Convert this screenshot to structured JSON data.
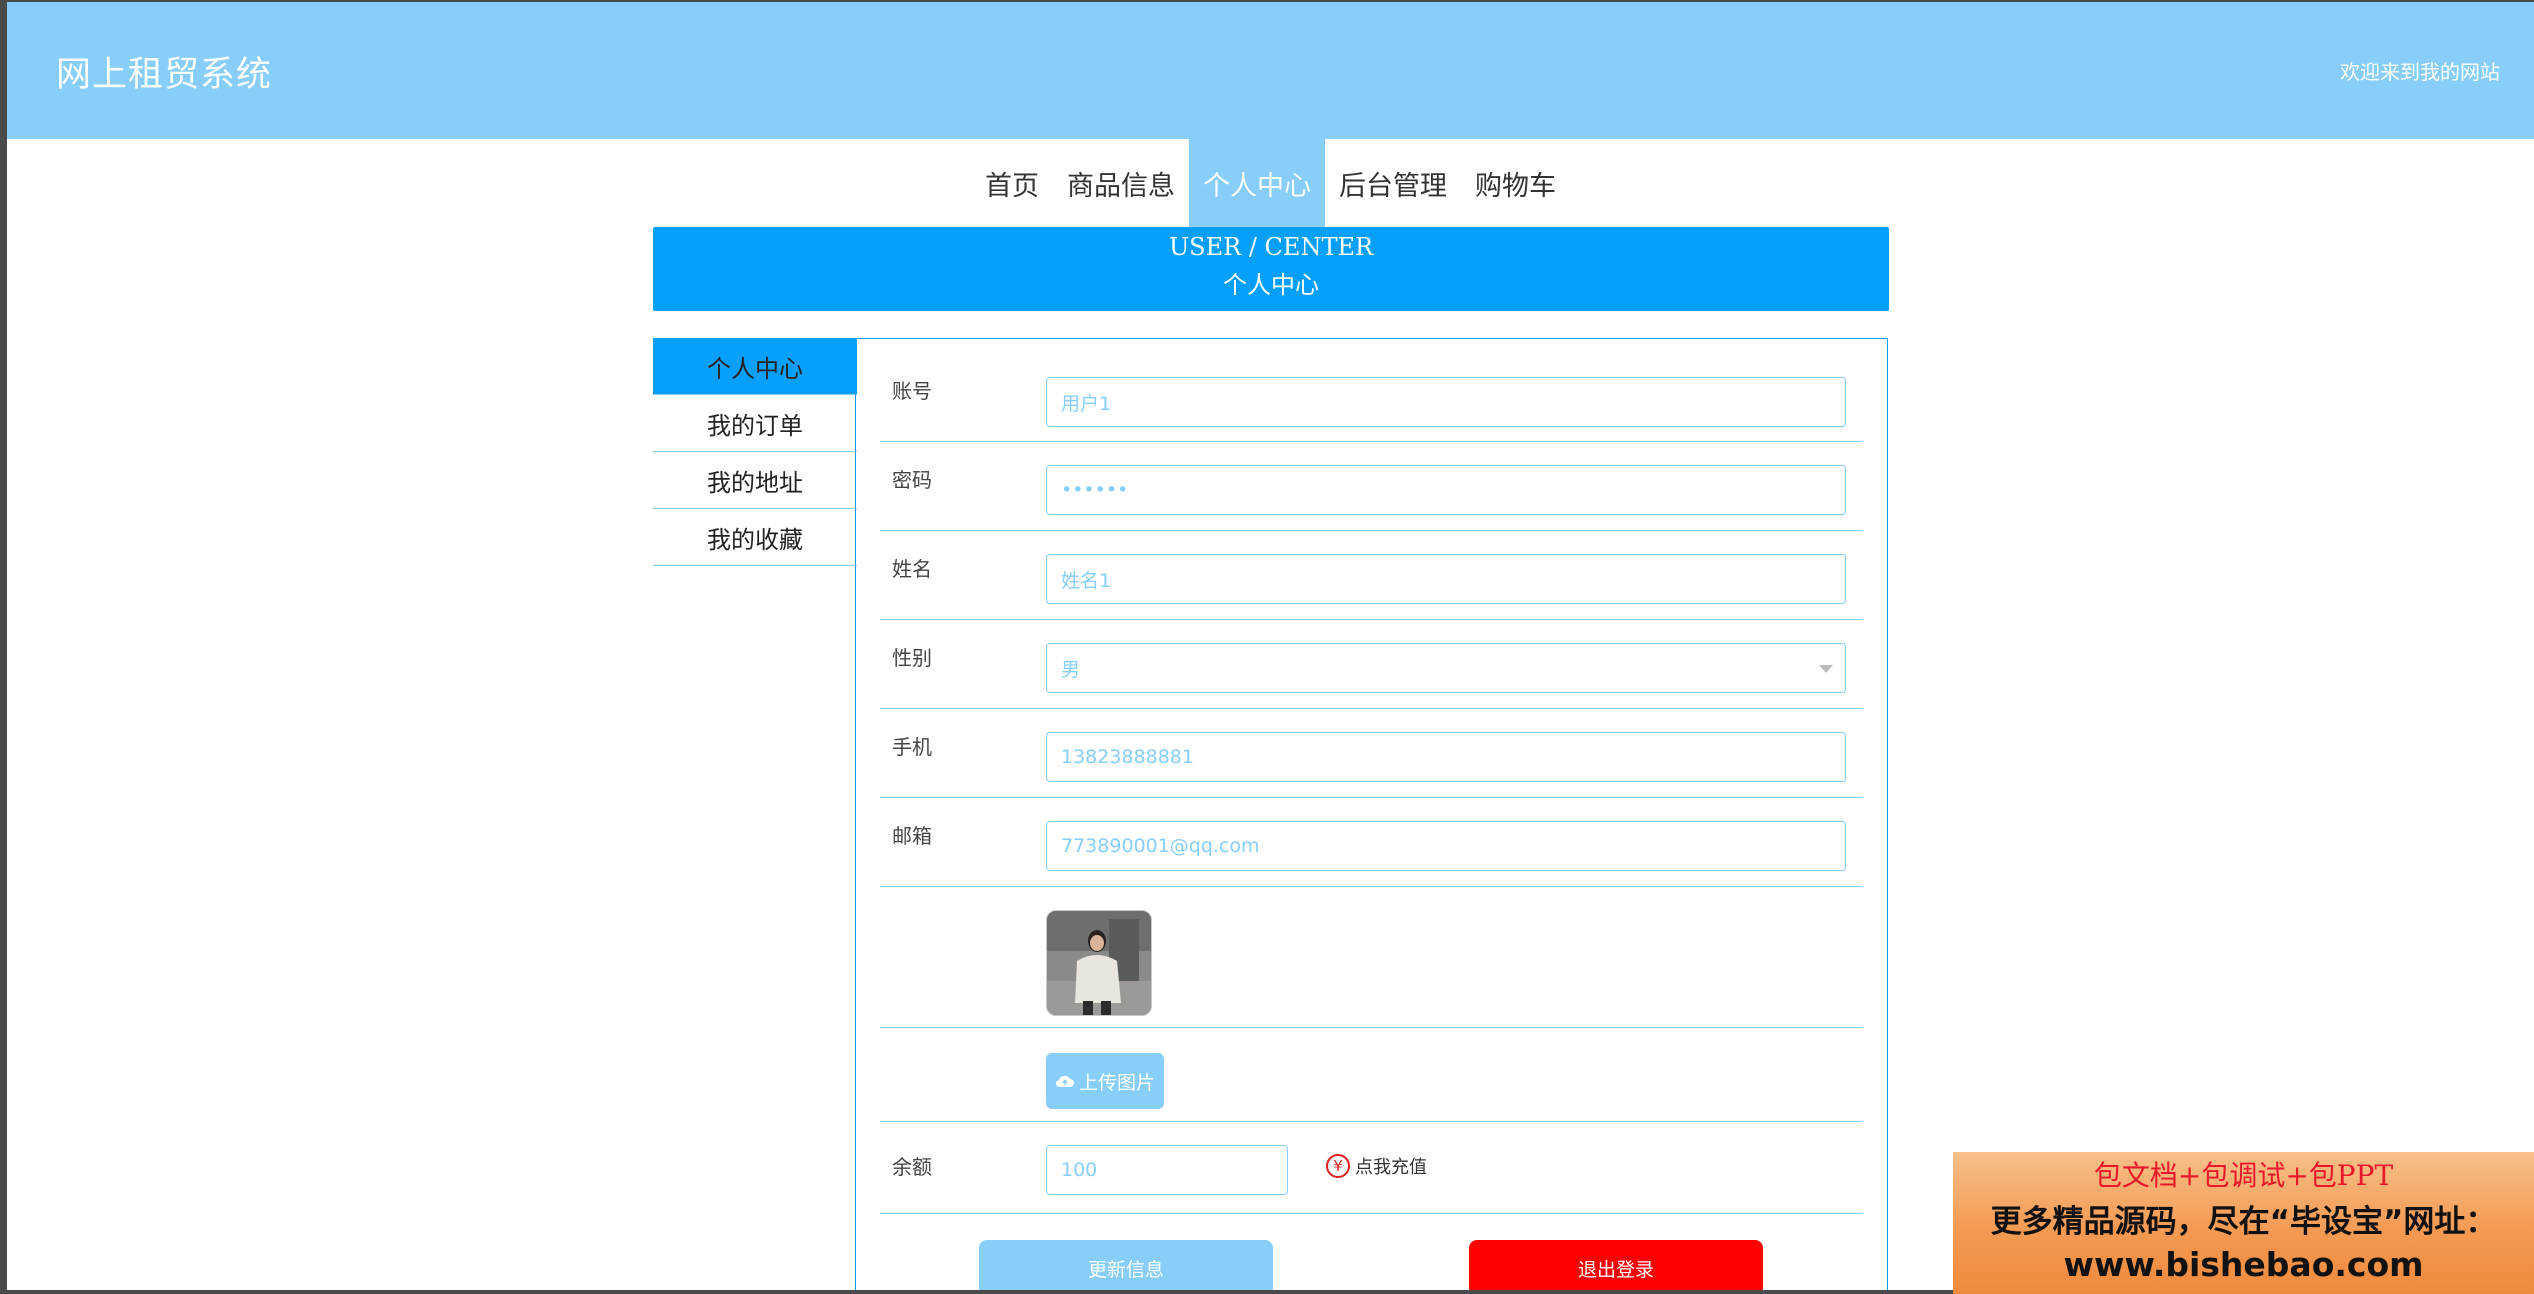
{
  "header": {
    "site_title": "网上租贸系统",
    "welcome": "欢迎来到我的网站"
  },
  "nav": {
    "items": [
      {
        "label": "首页"
      },
      {
        "label": "商品信息"
      },
      {
        "label": "个人中心"
      },
      {
        "label": "后台管理"
      },
      {
        "label": "购物车"
      }
    ],
    "active": "个人中心"
  },
  "banner": {
    "en": "USER / CENTER",
    "cn": "个人中心"
  },
  "sidebar": {
    "items": [
      {
        "label": "个人中心"
      },
      {
        "label": "我的订单"
      },
      {
        "label": "我的地址"
      },
      {
        "label": "我的收藏"
      }
    ],
    "active": "个人中心"
  },
  "form": {
    "account": {
      "label": "账号",
      "value": "用户1"
    },
    "password": {
      "label": "密码",
      "value": "••••••"
    },
    "name": {
      "label": "姓名",
      "value": "姓名1"
    },
    "gender": {
      "label": "性别",
      "value": "男"
    },
    "phone": {
      "label": "手机",
      "value": "13823888881"
    },
    "email": {
      "label": "邮箱",
      "value": "773890001@qq.com"
    },
    "upload_label": "上传图片",
    "balance": {
      "label": "余额",
      "value": "100"
    },
    "recharge_label": "点我充值",
    "recharge_icon": "¥",
    "update_label": "更新信息",
    "logout_label": "退出登录"
  },
  "ad": {
    "line1": "包文档+包调试+包PPT",
    "line2": "更多精品源码，尽在“毕设宝”网址：",
    "line3": "www.bishebao.com"
  },
  "colors": {
    "header": "#87cefa",
    "accent": "#069ffc",
    "logout": "#ff0000"
  }
}
